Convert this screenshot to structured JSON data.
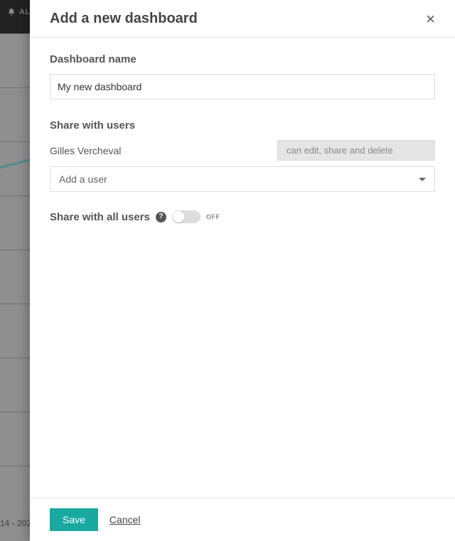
{
  "background": {
    "alert_label": "AL",
    "date_fragment": "14 - 202"
  },
  "panel": {
    "title": "Add a new dashboard",
    "close_glyph": "×"
  },
  "form": {
    "name_label": "Dashboard name",
    "name_value": "My new dashboard",
    "share_label": "Share with users",
    "shared_user": {
      "name": "Gilles Vercheval",
      "permission_text": "can edit, share and delete"
    },
    "add_user_placeholder": "Add a user",
    "share_all_label": "Share with all users",
    "help_glyph": "?",
    "toggle_state_text": "OFF"
  },
  "actions": {
    "save": "Save",
    "cancel": "Cancel"
  },
  "colors": {
    "primary": "#1aa9a0"
  }
}
